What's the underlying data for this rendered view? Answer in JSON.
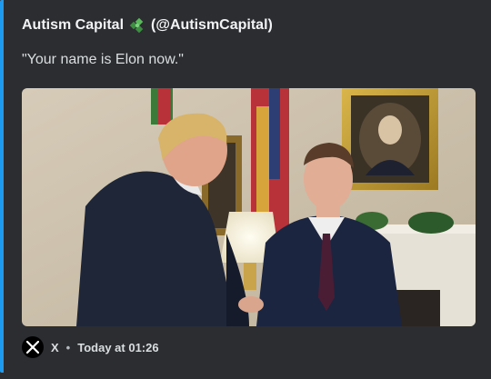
{
  "embed": {
    "accent_color": "#1d9bf0",
    "author": {
      "name": "Autism Capital",
      "emoji": "puzzle-piece-icon",
      "handle": "(@AutismCapital)"
    },
    "text": "\"Your name is Elon now.\"",
    "image": {
      "alt": "photo"
    },
    "footer": {
      "source_icon": "x-logo-icon",
      "source": "X",
      "separator": "•",
      "timestamp": "Today at 01:26"
    }
  }
}
